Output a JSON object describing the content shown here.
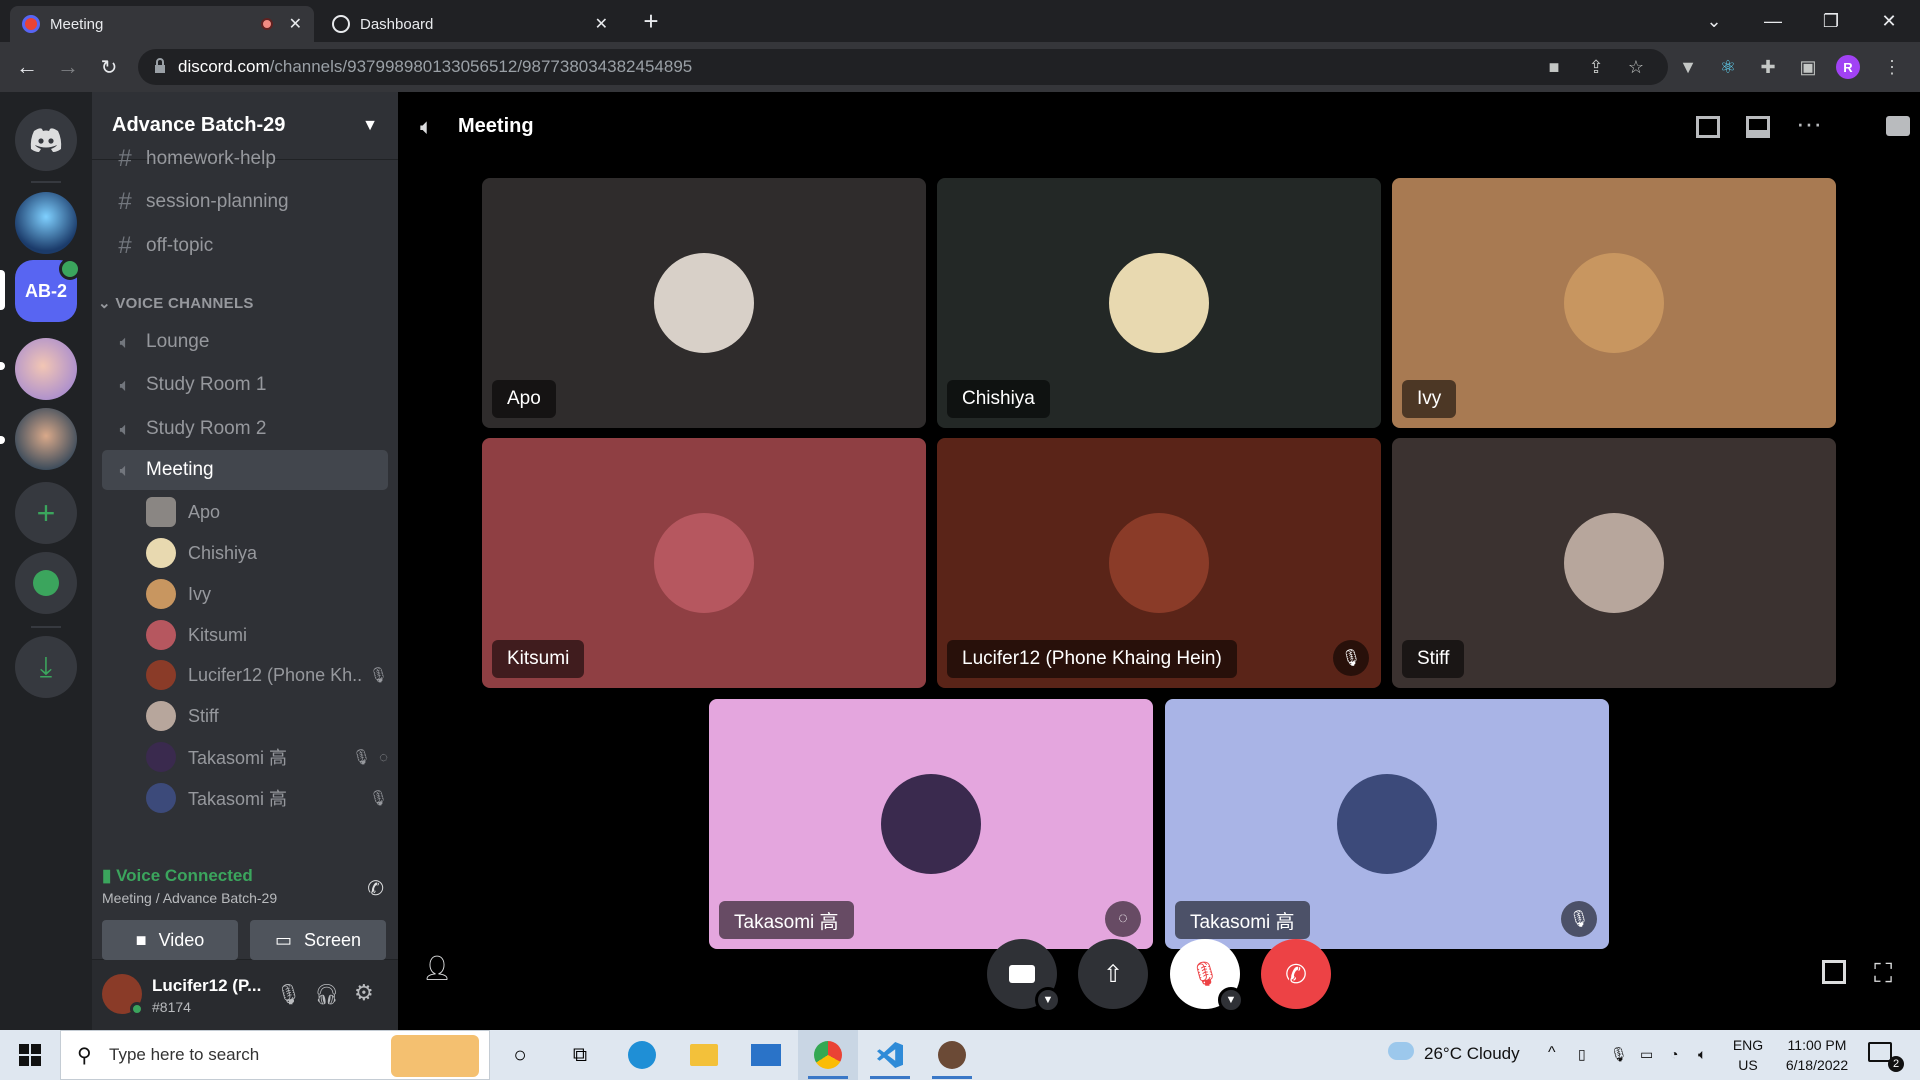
{
  "browser": {
    "tabs": [
      {
        "title": "Meeting",
        "close": "✕"
      },
      {
        "title": "Dashboard",
        "close": "✕"
      }
    ],
    "new_tab": "+",
    "url_host": "discord.com",
    "url_path": "/channels/937998980133056512/987738034382454895",
    "profile_initial": "R"
  },
  "guild": {
    "name": "Advance Batch-29",
    "active_server_label": "AB-2",
    "text_channels": [
      "homework-help",
      "session-planning",
      "off-topic"
    ],
    "voice_category": "VOICE CHANNELS",
    "voice_channels": [
      "Lounge",
      "Study Room 1",
      "Study Room 2",
      "Meeting"
    ],
    "voice_users": [
      {
        "name": "Apo"
      },
      {
        "name": "Chishiya"
      },
      {
        "name": "Ivy"
      },
      {
        "name": "Kitsumi"
      },
      {
        "name": "Lucifer12 (Phone Kh..."
      },
      {
        "name": "Stiff"
      },
      {
        "name": "Takasomi 高"
      },
      {
        "name": "Takasomi 高"
      }
    ],
    "voice_status": "Voice Connected",
    "voice_location": "Meeting / Advance Batch-29",
    "video_label": "Video",
    "screen_label": "Screen",
    "user_name": "Lucifer12 (P...",
    "user_tag": "#8174"
  },
  "meeting": {
    "title": "Meeting",
    "tiles": [
      {
        "name": "Apo",
        "bg": "#2f2c2c",
        "avatar": "#d8d0c8",
        "muted": false
      },
      {
        "name": "Chishiya",
        "bg": "#232826",
        "avatar": "#e8d9b0",
        "muted": false
      },
      {
        "name": "Ivy",
        "bg": "#a87a52",
        "avatar": "#c89660",
        "muted": false
      },
      {
        "name": "Kitsumi",
        "bg": "#8f3f43",
        "avatar": "#b6575f",
        "muted": false
      },
      {
        "name": "Lucifer12 (Phone Khaing Hein)",
        "bg": "#5a2418",
        "avatar": "#8a3b28",
        "muted": true
      },
      {
        "name": "Stiff",
        "bg": "#3b3230",
        "avatar": "#b7a69c",
        "muted": false
      },
      {
        "name": "Takasomi 高",
        "bg": "#e4a6de",
        "avatar": "#3a2a4e",
        "muted": false,
        "video_off": true
      },
      {
        "name": "Takasomi 高",
        "bg": "#a9b4e6",
        "avatar": "#3c4a7a",
        "muted": true
      }
    ]
  },
  "taskbar": {
    "search_placeholder": "Type here to search",
    "weather": "26°C  Cloudy",
    "lang": "ENG",
    "region": "US",
    "time": "11:00 PM",
    "date": "6/18/2022",
    "notif_count": "2"
  },
  "colors": {
    "green": "#3ba55d",
    "red": "#ed4245",
    "blurple": "#5865f2"
  }
}
